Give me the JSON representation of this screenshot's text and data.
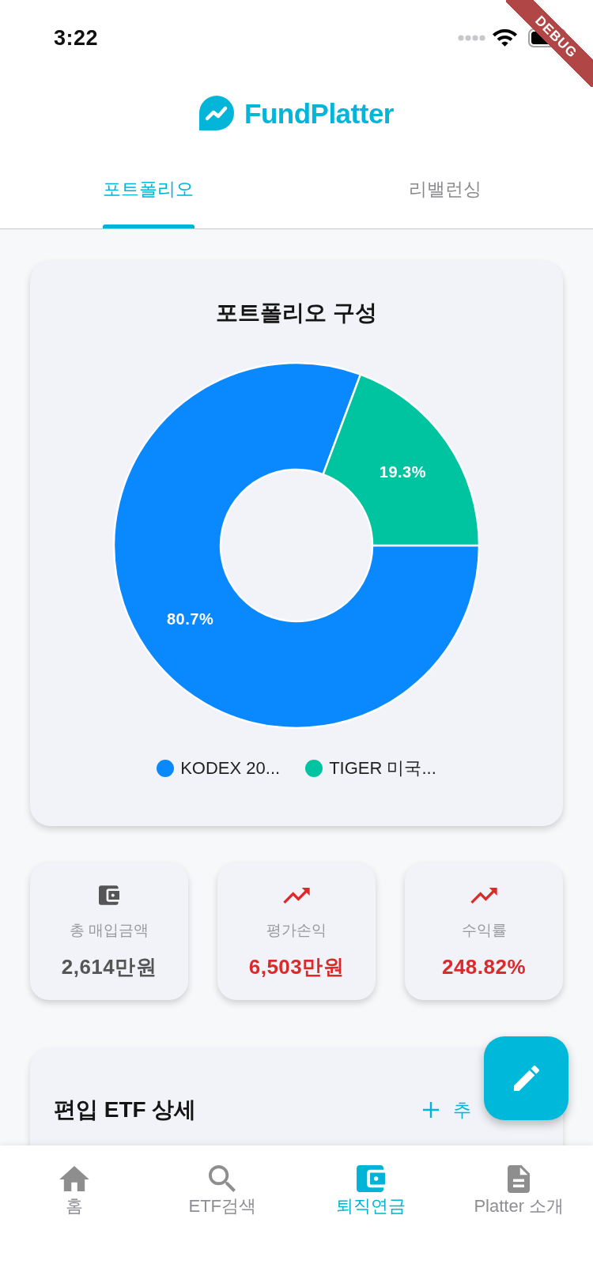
{
  "status_bar": {
    "time": "3:22"
  },
  "debug_banner": {
    "text": "DEBUG"
  },
  "header": {
    "logo_text": "FundPlatter"
  },
  "tabs": [
    {
      "label": "포트폴리오",
      "selected": true
    },
    {
      "label": "리밸런싱",
      "selected": false
    }
  ],
  "portfolio_card": {
    "chart_data": {
      "type": "donut",
      "title": "포트폴리오 구성",
      "categories": [
        "KODEX 20...",
        "TIGER 미국..."
      ],
      "values": [
        80.7,
        19.3
      ],
      "value_labels": [
        "80.7%",
        "19.3%"
      ],
      "colors": [
        "#0a88fe",
        "#00c4a0"
      ],
      "legend": "bottom"
    }
  },
  "stats": [
    {
      "kind": "wallet",
      "label": "총 매입금액",
      "value": "2,614만원",
      "color": "#555555"
    },
    {
      "kind": "trend",
      "label": "평가손익",
      "value": "6,503만원",
      "color": "#dc2a2a"
    },
    {
      "kind": "trend",
      "label": "수익률",
      "value": "248.82%",
      "color": "#dc2a2a"
    }
  ],
  "etf_detail": {
    "title": "편입 ETF 상세",
    "add_label": "추"
  },
  "bottom_nav": [
    {
      "kind": "home",
      "label": "홈",
      "selected": false
    },
    {
      "kind": "search",
      "label": "ETF검색",
      "selected": false
    },
    {
      "kind": "wallet",
      "label": "퇴직연금",
      "selected": true
    },
    {
      "kind": "document",
      "label": "Platter 소개",
      "selected": false
    }
  ]
}
